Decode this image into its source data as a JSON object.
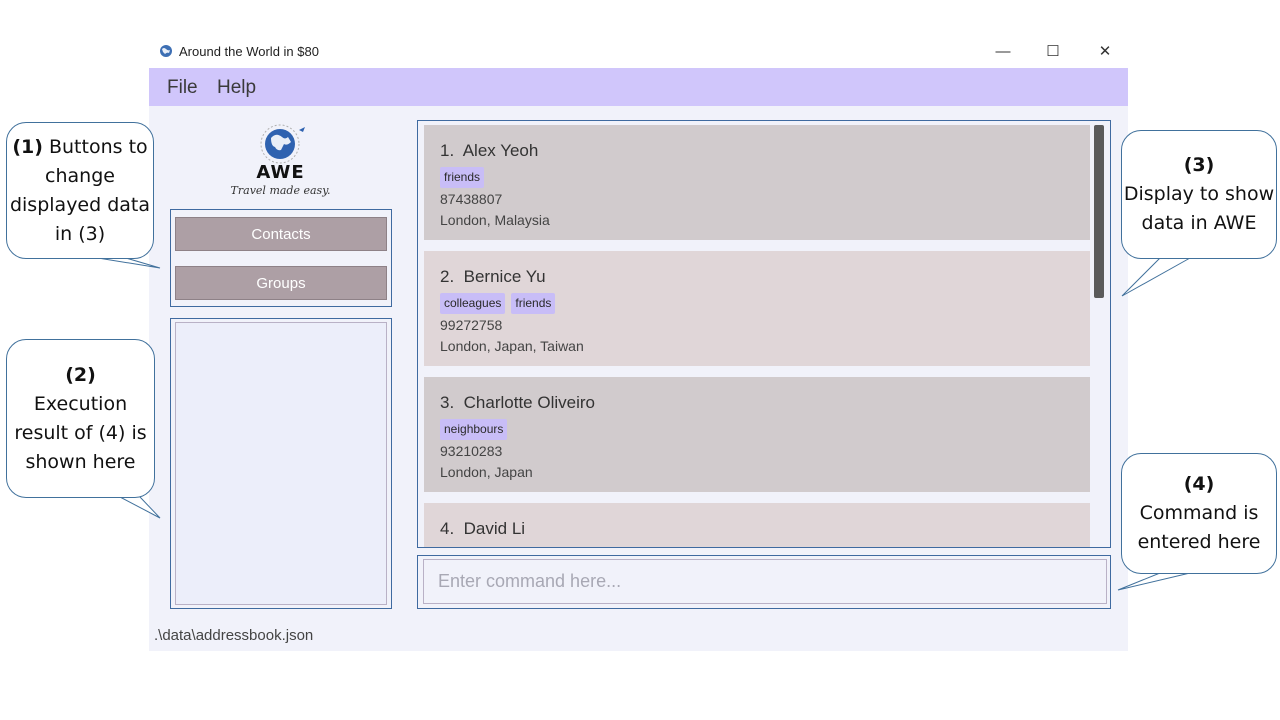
{
  "window": {
    "title": "Around the World in $80",
    "controls": {
      "minimize": "—",
      "maximize": "☐",
      "close": "✕"
    }
  },
  "menu": {
    "items": [
      "File",
      "Help"
    ]
  },
  "logo": {
    "title": "AWE",
    "tagline": "Travel made easy."
  },
  "nav": {
    "contacts_label": "Contacts",
    "groups_label": "Groups"
  },
  "persons": [
    {
      "index": "1.",
      "name": "Alex Yeoh",
      "tags": [
        "friends"
      ],
      "phone": "87438807",
      "countries": "London, Malaysia"
    },
    {
      "index": "2.",
      "name": "Bernice Yu",
      "tags": [
        "colleagues",
        "friends"
      ],
      "phone": "99272758",
      "countries": "London, Japan, Taiwan"
    },
    {
      "index": "3.",
      "name": "Charlotte Oliveiro",
      "tags": [
        "neighbours"
      ],
      "phone": "93210283",
      "countries": "London, Japan"
    },
    {
      "index": "4.",
      "name": "David Li",
      "tags": [],
      "phone": "",
      "countries": ""
    }
  ],
  "command": {
    "placeholder": "Enter command here...",
    "value": ""
  },
  "status": {
    "path": ".\\data\\addressbook.json"
  },
  "callouts": {
    "one": {
      "number": "(1)",
      "text": "Buttons to change displayed data in (3)"
    },
    "two": {
      "number": "(2)",
      "text": "Execution result of (4) is shown here"
    },
    "three": {
      "number": "(3)",
      "text": "Display to show data in AWE"
    },
    "four": {
      "number": "(4)",
      "text": "Command is entered here"
    }
  },
  "colors": {
    "menubar": "#d0c6fb",
    "tag": "#c8bdf7",
    "card_odd": "#d1cbcd",
    "card_even": "#e0d6d8",
    "nav_button": "#ad9fa5",
    "border": "#3f6aa0"
  }
}
